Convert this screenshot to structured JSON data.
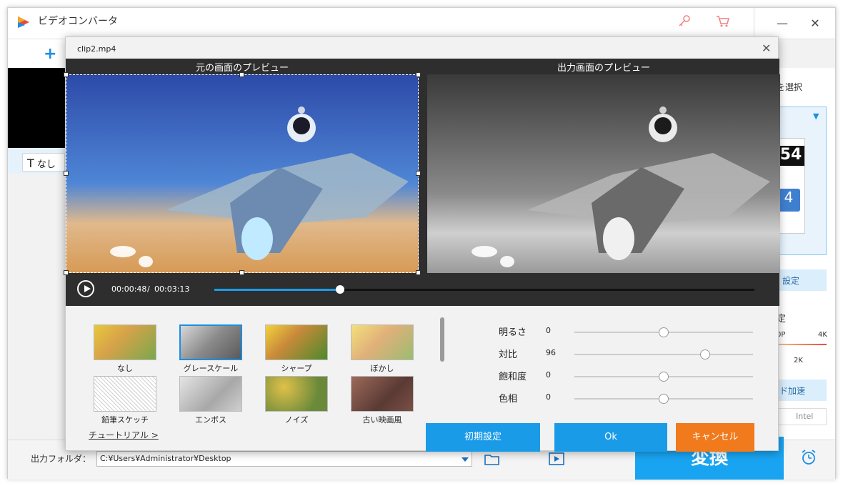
{
  "app": {
    "title": "ビデオコンバータ"
  },
  "title_icons": [
    "key-icon",
    "cart-icon"
  ],
  "window_controls": {
    "minimize": "—",
    "close": "✕"
  },
  "left": {
    "add_label": "+",
    "text_button": "なし"
  },
  "right": {
    "format_select_label": "を選択",
    "settings_label": "設定",
    "quality_label": "定",
    "scale_left": "0P",
    "scale_right": "4K",
    "scale_mid": "2K",
    "hw_accel_label": "ド加速",
    "intel_label": "Intel",
    "chip_text_1": "54",
    "chip_text_2": "4"
  },
  "bottom": {
    "output_folder_label": "出力フォルダ：",
    "path_value": "C:¥Users¥Administrator¥Desktop",
    "convert_label": "変換"
  },
  "dialog": {
    "title": "clip2.mp4",
    "close": "✕",
    "original_preview_label": "元の画面のプレビュー",
    "output_preview_label": "出力画面のプレビュー",
    "current_time": "00:00:48",
    "time_separator": "/",
    "total_time": "00:03:13",
    "progress": 0.233,
    "filters": [
      {
        "label": "なし",
        "selected": false
      },
      {
        "label": "グレースケール",
        "selected": true
      },
      {
        "label": "シャープ",
        "selected": false
      },
      {
        "label": "ぼかし",
        "selected": false
      },
      {
        "label": "鉛筆スケッチ",
        "selected": false
      },
      {
        "label": "エンボス",
        "selected": false
      },
      {
        "label": "ノイズ",
        "selected": false
      },
      {
        "label": "古い映画風",
        "selected": false
      }
    ],
    "adjustments": [
      {
        "name": "明るさ",
        "value": "0",
        "level": 0.5
      },
      {
        "name": "対比",
        "value": "96",
        "level": 0.73
      },
      {
        "name": "飽和度",
        "value": "0",
        "level": 0.5
      },
      {
        "name": "色相",
        "value": "0",
        "level": 0.5
      }
    ],
    "tutorial_link": "チュートリアル >",
    "reset_button": "初期設定",
    "ok_button": "Ok",
    "cancel_button": "キャンセル"
  },
  "colors": {
    "accent": "#1a9be8",
    "cancel": "#f07a1c",
    "convert": "#19a4f2"
  }
}
